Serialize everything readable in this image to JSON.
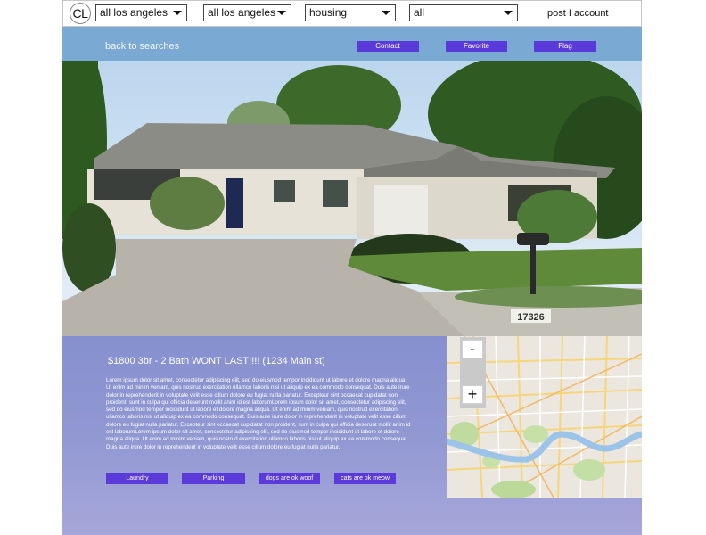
{
  "header": {
    "logo": "CL",
    "filters": [
      {
        "value": "all los angeles"
      },
      {
        "value": "all los angeles"
      },
      {
        "value": "housing"
      },
      {
        "value": "all"
      }
    ],
    "account_link": "post I account"
  },
  "nav": {
    "back_label": "back to searches",
    "actions": [
      "Contact",
      "Favorite",
      "Flag"
    ]
  },
  "listing": {
    "title": "$1800 3br - 2 Bath WONT LAST!!!! (1234 Main st)",
    "description": "Lorem ipsum dolor sit amet, consectetur adipiscing elit, sed do eiusmod tempor incididunt ut labore et dolore magna aliqua. Ut enim ad minim veniam, quis nostrud exercitation ullamco laboris nisi ut aliquip ex ea commodo consequat. Duis aute irure dolor in reprehenderit in voluptate velit esse cillum dolore eu fugiat nulla pariatur. Excepteur sint occaecat cupidatat non proident, sunt in culpa qui officia deserunt mollit anim id est laborumLorem ipsum dolor sit amet, consectetur adipiscing elit, sed do eiusmod tempor incididunt ut labore et dolore magna aliqua. Ut enim ad minim veniam, quis nostrud exercitation ullamco laboris nisi ut aliquip ex ea commodo consequat. Duis aute irure dolor in reprehenderit in voluptate velit esse cillum dolore eu fugiat nulla pariatur. Excepteur sint occaecat cupidatat non proident, sunt in culpa qui officia deserunt mollit anim id est laborumLorem ipsum dolor sit amet, consectetur adipiscing elit, sed do eiusmod tempor incididunt ut labore et dolore magna aliqua. Ut enim ad minim veniam, quis nostrud exercitation ullamco laboris nisi ut aliquip ex ea commodo consequat. Duis aute irure dolor in reprehenderit in voluptate velit esse cillum dolore eu fugiat nulla pariatur.",
    "house_number": "17326",
    "tags": [
      "Laundry",
      "Parking",
      "dogs are ok woof",
      "cats are ok meow"
    ]
  },
  "map": {
    "zoom_out": "-",
    "zoom_in": "+"
  },
  "colors": {
    "nav_band": "#7aaad4",
    "button": "#5a3ad8",
    "details_bg": "#8790cf"
  }
}
